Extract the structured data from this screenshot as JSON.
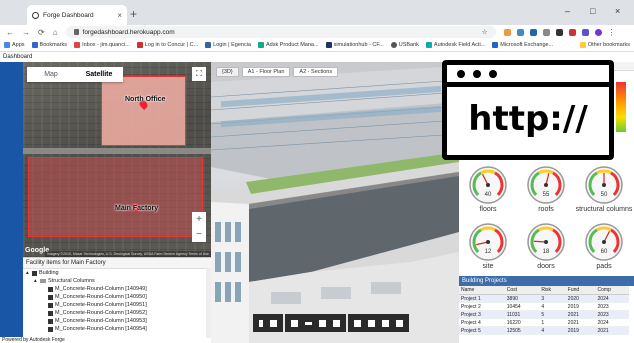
{
  "browser": {
    "tab_title": "Forge Dashboard",
    "url": "forgedashboard.herokuapp.com",
    "bookmarks": [
      "Apps",
      "Bookmarks",
      "Inbox - jim.quanci...",
      "Log in to Concur | C...",
      "Login | Egencia",
      "Adsk Product Mana...",
      "simulationhub - CF...",
      "USBank",
      "Autodesk Field Acti...",
      "Microsoft Exchange..."
    ],
    "other_bookmarks": "Other bookmarks"
  },
  "page": {
    "header": "Dashboard",
    "powered_by": "Powered by Autodesk Forge"
  },
  "map": {
    "toggle": [
      "Map",
      "Satellite"
    ],
    "active_toggle": "Satellite",
    "labels": {
      "north": "North Office",
      "main": "Main Factory"
    },
    "google": "Google",
    "attribution": "Imagery ©2019, Maxar Technologies, U.S. Geological Survey, USDA Farm Service Agency  Terms of Use",
    "zoom_in": "+",
    "zoom_out": "−",
    "fullscreen": "⛶"
  },
  "tree": {
    "title": "Facility items for Main Factory",
    "rows": [
      {
        "text": "Building",
        "level": 0,
        "type": "root"
      },
      {
        "text": "Structural Columns",
        "level": 1,
        "type": "folder"
      },
      {
        "text": "M_Concrete-Round-Column [140949]",
        "level": 2,
        "type": "item"
      },
      {
        "text": "M_Concrete-Round-Column [140950]",
        "level": 2,
        "type": "item"
      },
      {
        "text": "M_Concrete-Round-Column [140951]",
        "level": 2,
        "type": "item"
      },
      {
        "text": "M_Concrete-Round-Column [140952]",
        "level": 2,
        "type": "item"
      },
      {
        "text": "M_Concrete-Round-Column [140953]",
        "level": 2,
        "type": "item"
      },
      {
        "text": "M_Concrete-Round-Column [140954]",
        "level": 2,
        "type": "item"
      }
    ]
  },
  "viewer": {
    "tabs": [
      "{3D}",
      "A1 - Floor Plan",
      "A2 - Sections"
    ]
  },
  "overlay": {
    "text": "http://"
  },
  "gauges": [
    {
      "label": "floors",
      "value": 40
    },
    {
      "label": "roofs",
      "value": 55
    },
    {
      "label": "structural columns",
      "value": 50
    },
    {
      "label": "site",
      "value": 12
    },
    {
      "label": "doors",
      "value": 18
    },
    {
      "label": "pads",
      "value": 60
    }
  ],
  "projects": {
    "title": "Building Projects",
    "columns": [
      "Name",
      "Cost",
      "Risk",
      "Fund",
      "Comp"
    ],
    "rows": [
      [
        "Project 1",
        "3890",
        "3",
        "2020",
        "2024"
      ],
      [
        "Project 2",
        "10454",
        "4",
        "2019",
        "2023"
      ],
      [
        "Project 3",
        "11031",
        "5",
        "2021",
        "2023"
      ],
      [
        "Project 4",
        "16220",
        "1",
        "2021",
        "2024"
      ],
      [
        "Project 5",
        "12505",
        "4",
        "2019",
        "2021"
      ]
    ]
  },
  "colors": {
    "accent": "#1a56a6",
    "building_outline": "#e33333"
  }
}
